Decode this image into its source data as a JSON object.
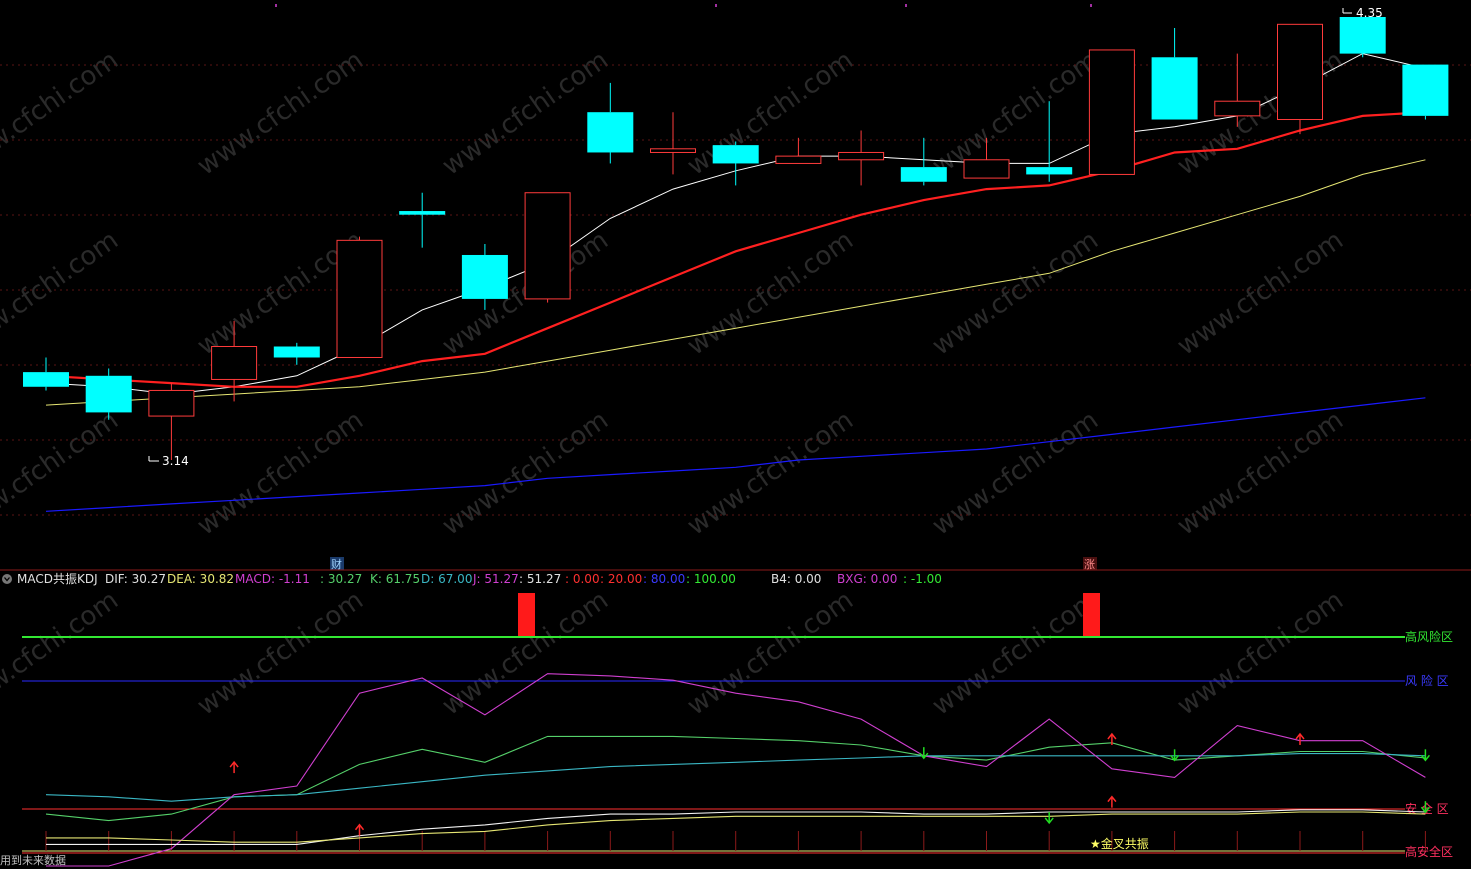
{
  "top_markers": [
    "财",
    "涨"
  ],
  "candle_chart": {
    "high_label": "4.35",
    "low_label": "3.14",
    "up_color": "#ff3b3b",
    "down_color": "#00ffff",
    "ma_colors": [
      "#ffffff",
      "#ff2020",
      "#e6e673",
      "#1a1aff"
    ]
  },
  "indicator": {
    "name": "MACD共振KDJ",
    "dif": "DIF: 30.27",
    "dea": "DEA: 30.82",
    "macd": "MACD: -1.11",
    "v1": ": 30.27",
    "k": "K: 61.75",
    "d": "D: 67.00",
    "j": "J: 51.27",
    "v2": ": 51.27",
    "v3": ": 0.00",
    "v4": ": 20.00",
    "v5": ": 80.00",
    "v6": ": 100.00",
    "b4": "B4: 0.00",
    "bxg": "BXG: 0.00",
    "v7": ": -1.00",
    "zone_high_risk": "高风险区",
    "zone_risk": "风 险 区",
    "zone_safe": "安 全 区",
    "zone_high_safe": "高安全区",
    "golden_cross": "★金叉共振",
    "footer": "用到未来数据"
  },
  "chart_data": [
    {
      "type": "candlestick",
      "title": "",
      "annotations": [
        "4.35",
        "3.14"
      ],
      "candles": [
        {
          "open": 3.38,
          "close": 3.34,
          "high": 3.42,
          "low": 3.33
        },
        {
          "open": 3.37,
          "close": 3.27,
          "high": 3.39,
          "low": 3.25
        },
        {
          "open": 3.26,
          "close": 3.33,
          "high": 3.35,
          "low": 3.14
        },
        {
          "open": 3.36,
          "close": 3.45,
          "high": 3.52,
          "low": 3.3
        },
        {
          "open": 3.45,
          "close": 3.42,
          "high": 3.46,
          "low": 3.4
        },
        {
          "open": 3.42,
          "close": 3.74,
          "high": 3.75,
          "low": 3.42
        },
        {
          "open": 3.82,
          "close": 3.81,
          "high": 3.87,
          "low": 3.72
        },
        {
          "open": 3.7,
          "close": 3.58,
          "high": 3.73,
          "low": 3.55
        },
        {
          "open": 3.58,
          "close": 3.87,
          "high": 3.87,
          "low": 3.57
        },
        {
          "open": 4.09,
          "close": 3.98,
          "high": 4.17,
          "low": 3.95
        },
        {
          "open": 3.98,
          "close": 3.99,
          "high": 4.09,
          "low": 3.92
        },
        {
          "open": 4.0,
          "close": 3.95,
          "high": 4.01,
          "low": 3.89
        },
        {
          "open": 3.95,
          "close": 3.97,
          "high": 4.02,
          "low": 3.95
        },
        {
          "open": 3.96,
          "close": 3.98,
          "high": 4.04,
          "low": 3.89
        },
        {
          "open": 3.94,
          "close": 3.9,
          "high": 4.02,
          "low": 3.89
        },
        {
          "open": 3.91,
          "close": 3.96,
          "high": 4.02,
          "low": 3.91
        },
        {
          "open": 3.94,
          "close": 3.92,
          "high": 4.12,
          "low": 3.9
        },
        {
          "open": 3.92,
          "close": 4.26,
          "high": 4.26,
          "low": 3.92
        },
        {
          "open": 4.24,
          "close": 4.07,
          "high": 4.32,
          "low": 4.07
        },
        {
          "open": 4.08,
          "close": 4.12,
          "high": 4.25,
          "low": 4.05
        },
        {
          "open": 4.07,
          "close": 4.33,
          "high": 4.33,
          "low": 4.03
        },
        {
          "open": 4.35,
          "close": 4.25,
          "high": 4.35,
          "low": 4.24
        },
        {
          "open": 4.22,
          "close": 4.08,
          "high": 4.22,
          "low": 4.07
        }
      ],
      "ma_series": [
        {
          "values": [
            3.35,
            3.34,
            3.32,
            3.34,
            3.37,
            3.45,
            3.55,
            3.61,
            3.68,
            3.8,
            3.88,
            3.93,
            3.97,
            3.97,
            3.96,
            3.95,
            3.95,
            4.03,
            4.05,
            4.08,
            4.16,
            4.25,
            4.21
          ]
        },
        {
          "values": [
            3.37,
            3.36,
            3.35,
            3.34,
            3.34,
            3.37,
            3.41,
            3.43,
            3.5,
            3.57,
            3.64,
            3.71,
            3.76,
            3.81,
            3.85,
            3.88,
            3.89,
            3.93,
            3.98,
            3.99,
            4.04,
            4.08,
            4.09
          ]
        },
        {
          "values": [
            3.29,
            3.3,
            3.31,
            3.32,
            3.33,
            3.34,
            3.36,
            3.38,
            3.41,
            3.44,
            3.47,
            3.5,
            3.53,
            3.56,
            3.59,
            3.62,
            3.65,
            3.71,
            3.76,
            3.81,
            3.86,
            3.92,
            3.96
          ]
        },
        {
          "values": [
            3.0,
            3.01,
            3.02,
            3.03,
            3.04,
            3.05,
            3.06,
            3.07,
            3.09,
            3.1,
            3.11,
            3.12,
            3.14,
            3.15,
            3.16,
            3.17,
            3.19,
            3.21,
            3.23,
            3.25,
            3.27,
            3.29,
            3.31
          ]
        }
      ]
    },
    {
      "type": "line",
      "title": "MACD共振KDJ",
      "levels": [
        0,
        20,
        80,
        100
      ],
      "series": [
        {
          "name": "K",
          "color": "#55d06a",
          "values": [
            18,
            15,
            18,
            26,
            27,
            41,
            48,
            42,
            54,
            54,
            54,
            53,
            52,
            50,
            45,
            43,
            49,
            51,
            43,
            45,
            47,
            47,
            44
          ]
        },
        {
          "name": "D",
          "color": "#3ab7c4",
          "values": [
            27,
            26,
            24,
            26,
            27,
            30,
            33,
            36,
            38,
            40,
            41,
            42,
            43,
            44,
            45,
            45,
            45,
            45,
            45,
            45,
            46,
            46,
            45
          ]
        },
        {
          "name": "J",
          "color": "#cf3fcf",
          "values": [
            -6,
            -6,
            2,
            27,
            31,
            74,
            81,
            64,
            83,
            82,
            80,
            74,
            70,
            62,
            45,
            40,
            62,
            39,
            35,
            59,
            52,
            52,
            35
          ]
        },
        {
          "name": "DIF",
          "color": "#f2f2f2",
          "values": [
            4,
            4,
            4,
            4,
            4,
            8,
            11,
            13,
            16,
            18,
            18,
            19,
            19,
            19,
            18,
            18,
            19,
            19,
            19,
            19,
            20,
            20,
            19
          ]
        },
        {
          "name": "DEA",
          "color": "#e6e673",
          "values": [
            7,
            7,
            6,
            5,
            5,
            7,
            9,
            10,
            13,
            15,
            16,
            17,
            17,
            17,
            17,
            17,
            17,
            18,
            18,
            18,
            19,
            19,
            18
          ]
        }
      ]
    }
  ]
}
